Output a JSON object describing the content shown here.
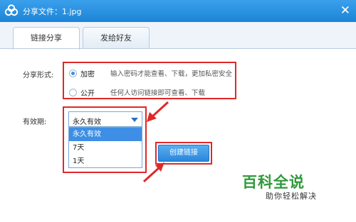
{
  "window": {
    "title": "分享文件：1.jpg",
    "close_glyph": "✕"
  },
  "tabs": [
    {
      "label": "链接分享",
      "active": true
    },
    {
      "label": "发给好友",
      "active": false
    }
  ],
  "share_form": {
    "label": "分享形式:",
    "options": [
      {
        "label": "加密",
        "description": "输入密码才能查看、下载，更加私密安全",
        "checked": true
      },
      {
        "label": "公开",
        "description": "任何人访问链接即可查看、下载",
        "checked": false
      }
    ]
  },
  "validity": {
    "label": "有效期:",
    "selected": "永久有效",
    "options": [
      "永久有效",
      "7天",
      "1天"
    ]
  },
  "create_link_button": "创建链接",
  "watermark": {
    "logo": "百科全说",
    "slogan": "助你轻松解决"
  },
  "colors": {
    "accent": "#2b86dc",
    "highlight": "#e02828",
    "watermark": "#2f9a3a"
  },
  "icons": [
    "cloud-logo-icon",
    "close-icon",
    "radio-icon",
    "caret-down-icon",
    "arrow-icon"
  ]
}
